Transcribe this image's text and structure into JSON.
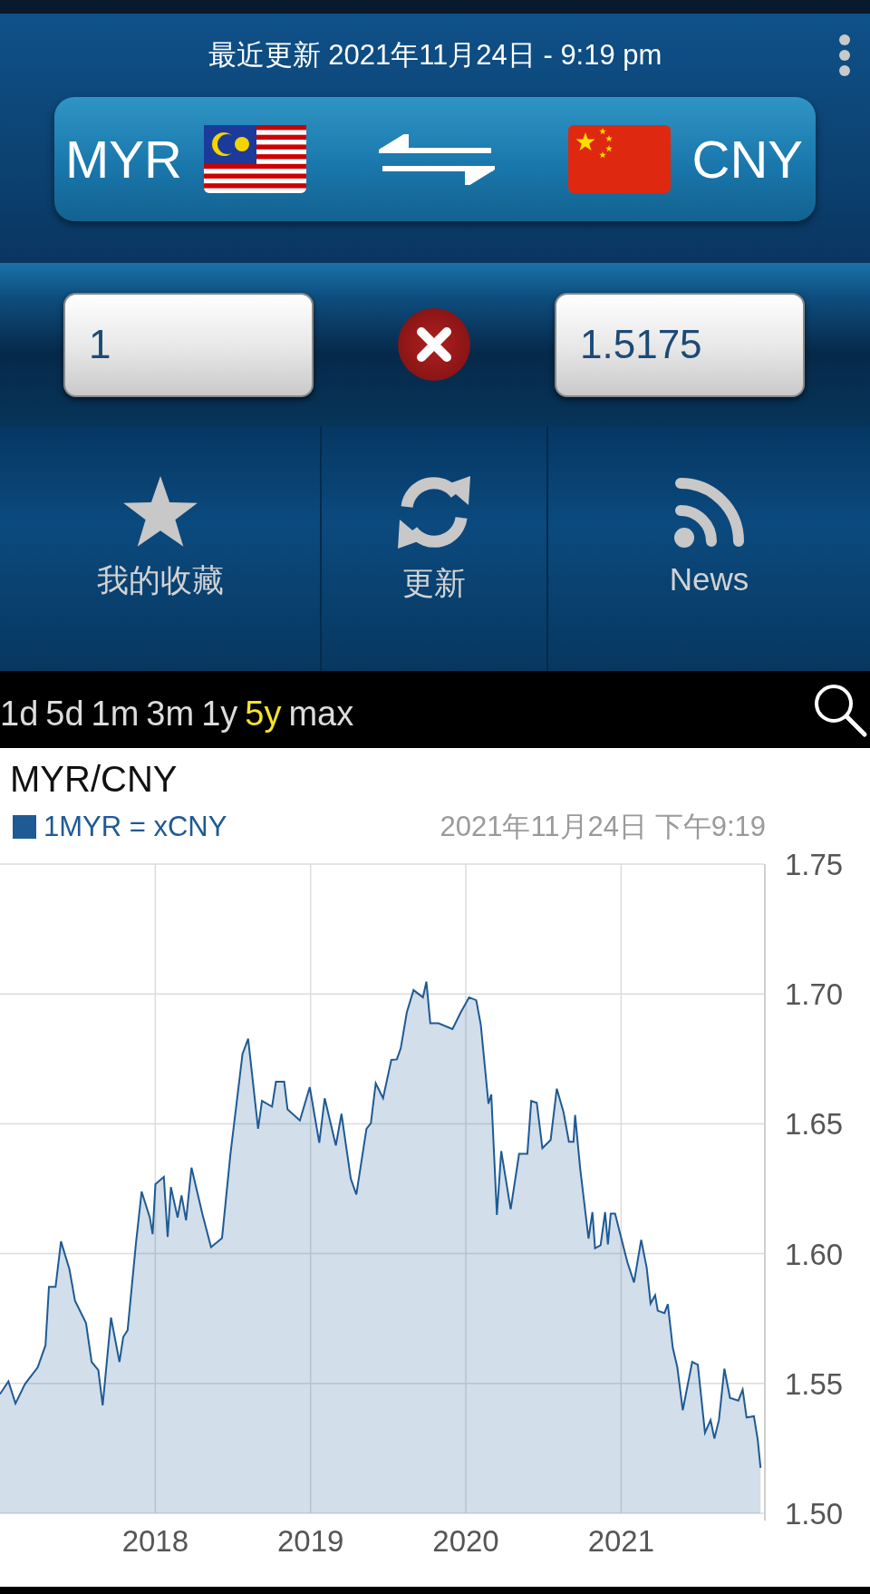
{
  "header": {
    "last_updated": "最近更新 2021年11月24日 - 9:19 pm"
  },
  "currency_pair": {
    "from": {
      "code": "MYR"
    },
    "to": {
      "code": "CNY"
    }
  },
  "amounts": {
    "from_value": "1",
    "to_value": "1.5175"
  },
  "actions": [
    {
      "label": "我的收藏",
      "kind": "star"
    },
    {
      "label": "更新",
      "kind": "refresh"
    },
    {
      "label": "News",
      "kind": "rss"
    }
  ],
  "ranges": [
    {
      "label": "1d",
      "selected": false
    },
    {
      "label": "5d",
      "selected": false
    },
    {
      "label": "1m",
      "selected": false
    },
    {
      "label": "3m",
      "selected": false
    },
    {
      "label": "1y",
      "selected": false
    },
    {
      "label": "5y",
      "selected": true
    },
    {
      "label": "max",
      "selected": false
    }
  ],
  "chart": {
    "title": "MYR/CNY",
    "timestamp": "2021年11月24日 下午9:19",
    "chart_data": {
      "type": "area",
      "x": [
        2017.0,
        2017.054,
        2017.1,
        2017.161,
        2017.243,
        2017.293,
        2017.315,
        2017.358,
        2017.393,
        2017.447,
        2017.483,
        2017.554,
        2017.59,
        2017.633,
        2017.661,
        2017.715,
        2017.769,
        2017.794,
        2017.822,
        2017.876,
        2017.912,
        2017.965,
        2017.983,
        2018.001,
        2018.055,
        2018.08,
        2018.101,
        2018.144,
        2018.169,
        2018.198,
        2018.233,
        2018.305,
        2018.359,
        2018.43,
        2018.484,
        2018.562,
        2018.598,
        2018.662,
        2018.687,
        2018.752,
        2018.777,
        2018.83,
        2018.852,
        2018.931,
        2018.995,
        2019.056,
        2019.091,
        2019.163,
        2019.199,
        2019.259,
        2019.295,
        2019.36,
        2019.388,
        2019.42,
        2019.467,
        2019.52,
        2019.556,
        2019.581,
        2019.62,
        2019.663,
        2019.724,
        2019.746,
        2019.771,
        2019.824,
        2019.914,
        2019.967,
        2020.021,
        2020.067,
        2020.096,
        2020.146,
        2020.164,
        2020.2,
        2020.228,
        2020.289,
        2020.343,
        2020.396,
        2020.421,
        2020.457,
        2020.493,
        2020.546,
        2020.586,
        2020.629,
        2020.664,
        2020.693,
        2020.704,
        2020.736,
        2020.79,
        2020.815,
        2020.832,
        2020.868,
        2020.897,
        2020.915,
        2020.933,
        2020.961,
        2021.04,
        2021.083,
        2021.129,
        2021.165,
        2021.19,
        2021.219,
        2021.236,
        2021.279,
        2021.301,
        2021.333,
        2021.362,
        2021.397,
        2021.458,
        2021.494,
        2021.54,
        2021.576,
        2021.601,
        2021.63,
        2021.665,
        2021.701,
        2021.755,
        2021.783,
        2021.808,
        2021.855,
        2021.88,
        2021.898
      ],
      "series": [
        {
          "name": "1MYR = xCNY",
          "color": "#1f5a94",
          "values": [
            1.5459,
            1.5508,
            1.5423,
            1.5498,
            1.5562,
            1.5647,
            1.5872,
            1.5872,
            1.6047,
            1.594,
            1.5818,
            1.5733,
            1.5583,
            1.5551,
            1.5416,
            1.5754,
            1.5583,
            1.5679,
            1.5705,
            1.6043,
            1.6239,
            1.6139,
            1.6075,
            1.6267,
            1.6295,
            1.6064,
            1.6256,
            1.6139,
            1.6224,
            1.6128,
            1.6331,
            1.6149,
            1.6025,
            1.606,
            1.6384,
            1.6769,
            1.6827,
            1.6481,
            1.6588,
            1.6566,
            1.6662,
            1.6662,
            1.6555,
            1.6513,
            1.6641,
            1.6427,
            1.6598,
            1.6417,
            1.6538,
            1.6288,
            1.6228,
            1.6481,
            1.6502,
            1.6656,
            1.6598,
            1.6746,
            1.6748,
            1.6791,
            1.6929,
            1.7015,
            1.6987,
            1.7047,
            1.6887,
            1.6887,
            1.6865,
            1.6929,
            1.6987,
            1.6976,
            1.6882,
            1.6577,
            1.6613,
            1.6149,
            1.6395,
            1.6171,
            1.6384,
            1.6384,
            1.6588,
            1.6581,
            1.6406,
            1.6438,
            1.6635,
            1.6545,
            1.6431,
            1.6431,
            1.6534,
            1.6331,
            1.6058,
            1.616,
            1.6021,
            1.6032,
            1.616,
            1.6036,
            1.6154,
            1.6154,
            1.5968,
            1.5889,
            1.6053,
            1.5946,
            1.5808,
            1.584,
            1.578,
            1.5771,
            1.5805,
            1.5637,
            1.5562,
            1.5397,
            1.5583,
            1.5572,
            1.531,
            1.5359,
            1.5288,
            1.5359,
            1.5557,
            1.5444,
            1.5434,
            1.5476,
            1.5369,
            1.5374,
            1.5284,
            1.5175
          ]
        }
      ],
      "grid": true,
      "xlim": [
        2017,
        2021.92
      ],
      "ylim": [
        1.5,
        1.75
      ],
      "xticks": [
        2018,
        2019,
        2020,
        2021
      ],
      "yticks": [
        {
          "value": 1.5,
          "label": "1.50"
        },
        {
          "value": 1.55,
          "label": "1.55"
        },
        {
          "value": 1.6,
          "label": "1.60"
        },
        {
          "value": 1.65,
          "label": "1.65"
        },
        {
          "value": 1.7,
          "label": "1.70"
        },
        {
          "value": 1.75,
          "label": "1.75"
        }
      ]
    }
  }
}
